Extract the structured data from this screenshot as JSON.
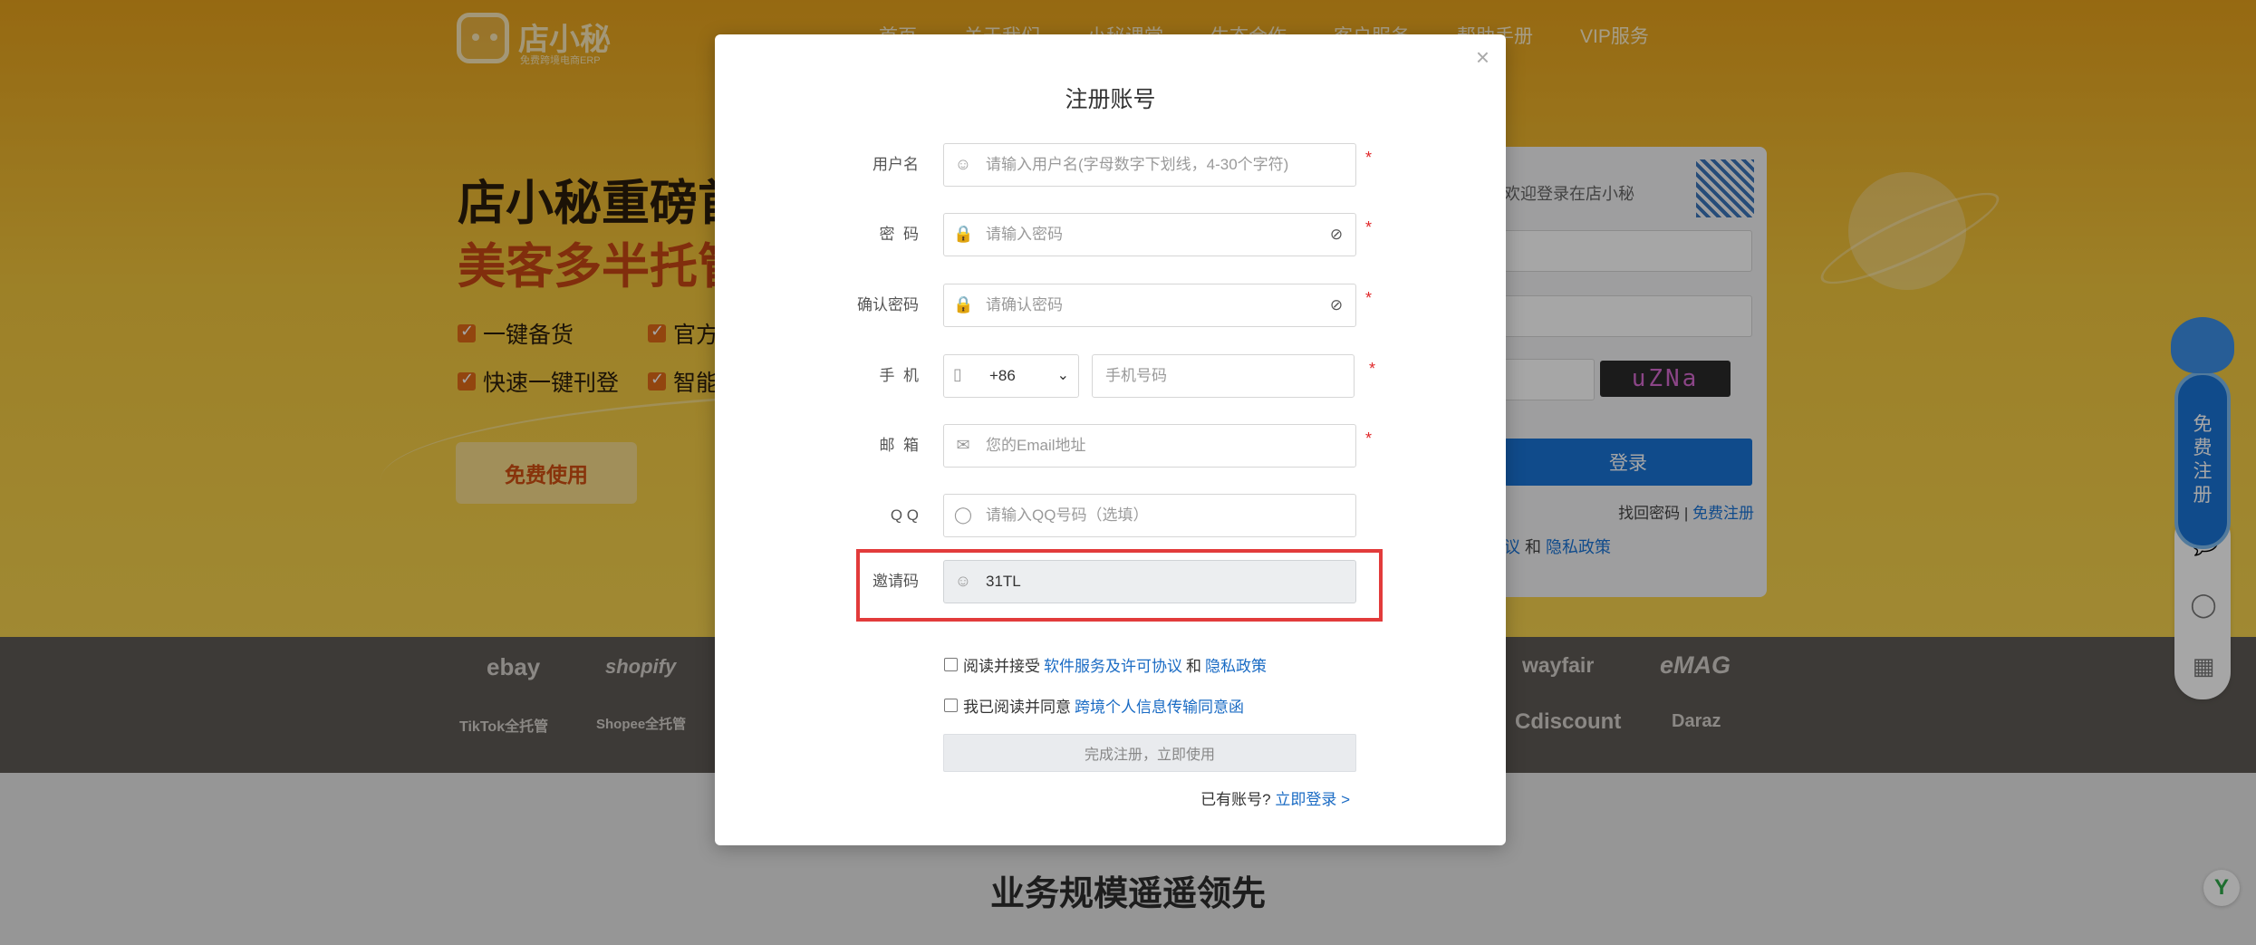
{
  "background": {
    "logo": {
      "brand": "店小秘",
      "sub": "免费跨境电商ERP"
    },
    "nav": [
      "首页",
      "关于我们",
      "小秘课堂",
      "生态合作",
      "客户服务",
      "帮助手册",
      "VIP服务"
    ],
    "headline": {
      "line1": "店小秘重磅首",
      "line2": "美客多半托管"
    },
    "features": [
      "一键备货",
      "官方",
      "快速一键刊登",
      "智能"
    ],
    "free_button": "免费使用",
    "login_card": {
      "welcome": "欢迎登录在店小秘",
      "captcha": "uZNa",
      "login_button": "登录",
      "forgot": "找回密码",
      "separator": "|",
      "register": "免费注册",
      "agree_left": "议",
      "agree_and": "和",
      "agree_privacy": "隐私政策"
    },
    "partners": [
      "ebay",
      "shopify",
      "wayfair",
      "eMAG",
      "TikTok全托管",
      "Shopee全托管",
      "Cdiscount",
      "Daraz"
    ],
    "bottom_title": "业务规模遥遥领先",
    "float_bar": {
      "register_label": [
        "免",
        "费",
        "注",
        "册"
      ]
    },
    "icons": [
      "chat-icon",
      "qq-icon",
      "qrcode-icon"
    ]
  },
  "modal": {
    "title": "注册账号",
    "close": "×",
    "required_mark": "*",
    "fields": {
      "username": {
        "label": "用户名",
        "placeholder": "请输入用户名(字母数字下划线，4-30个字符)"
      },
      "password": {
        "label": "密  码",
        "placeholder": "请输入密码"
      },
      "confirm_password": {
        "label": "确认密码",
        "placeholder": "请确认密码"
      },
      "phone": {
        "label": "手  机",
        "country_code": "+86",
        "placeholder": "手机号码"
      },
      "email": {
        "label": "邮  箱",
        "placeholder": "您的Email地址"
      },
      "qq": {
        "label": "Q Q",
        "placeholder": "请输入QQ号码（选填）"
      },
      "invite": {
        "label": "邀请码",
        "value": "31TL"
      }
    },
    "agreement1": {
      "text": "阅读并接受",
      "link1": "软件服务及许可协议",
      "and": "和",
      "link2": "隐私政策"
    },
    "agreement2": {
      "text": "我已阅读并同意",
      "link": "跨境个人信息传输同意函"
    },
    "submit": "完成注册，立即使用",
    "have_account": {
      "text": "已有账号?",
      "link": "立即登录 >"
    }
  }
}
